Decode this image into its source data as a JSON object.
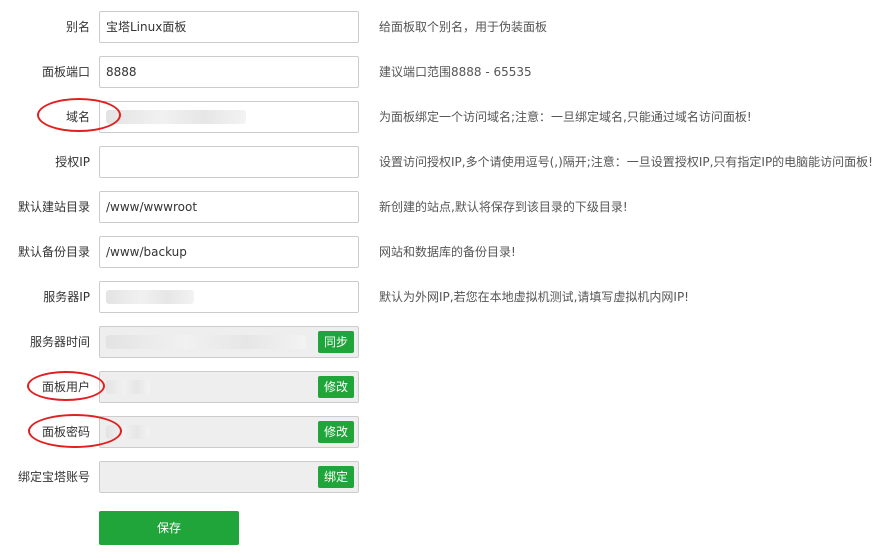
{
  "form": {
    "alias": {
      "label": "别名",
      "value": "宝塔Linux面板",
      "hint": "给面板取个别名，用于伪装面板"
    },
    "port": {
      "label": "面板端口",
      "value": "8888",
      "hint": "建议端口范围8888 - 65535"
    },
    "domain": {
      "label": "域名",
      "value": "",
      "hint": "为面板绑定一个访问域名;注意：一旦绑定域名,只能通过域名访问面板!"
    },
    "auth_ip": {
      "label": "授权IP",
      "value": "",
      "hint": "设置访问授权IP,多个请使用逗号(,)隔开;注意：一旦设置授权IP,只有指定IP的电脑能访问面板!"
    },
    "site_dir": {
      "label": "默认建站目录",
      "value": "/www/wwwroot",
      "hint": "新创建的站点,默认将保存到该目录的下级目录!"
    },
    "backup_dir": {
      "label": "默认备份目录",
      "value": "/www/backup",
      "hint": "网站和数据库的备份目录!"
    },
    "server_ip": {
      "label": "服务器IP",
      "value": "",
      "hint": "默认为外网IP,若您在本地虚拟机测试,请填写虚拟机内网IP!"
    },
    "server_time": {
      "label": "服务器时间",
      "button": "同步"
    },
    "panel_user": {
      "label": "面板用户",
      "button": "修改"
    },
    "panel_password": {
      "label": "面板密码",
      "button": "修改"
    },
    "bind_account": {
      "label": "绑定宝塔账号",
      "button": "绑定"
    }
  },
  "save_button": "保存",
  "colors": {
    "accent": "#20a53a",
    "annotation": "#e02020",
    "readonly_bg": "#eeeeee"
  }
}
